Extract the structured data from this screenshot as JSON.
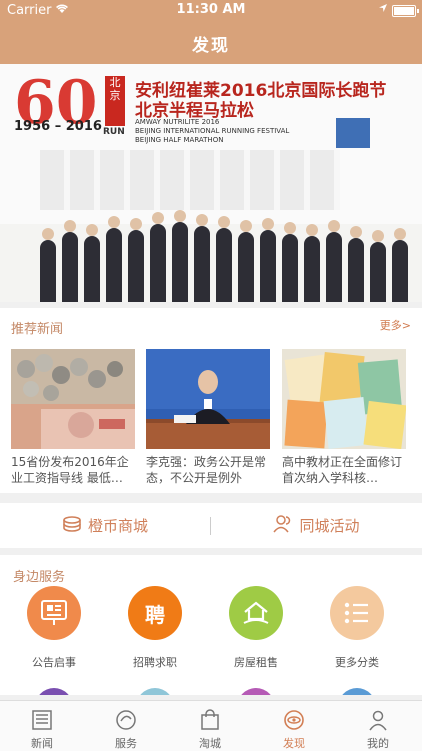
{
  "status_bar": {
    "carrier": "Carrier",
    "time": "11:30 AM"
  },
  "nav": {
    "title": "发现"
  },
  "banner": {
    "logo_number": "60",
    "logo_years": "1956 – 2016",
    "badge_text": "北京",
    "badge_run": "RUN",
    "title_line1": "安利纽崔莱2016北京国际长跑节",
    "title_line2": "北京半程马拉松",
    "subtitle_en": "AMWAY NUTRILITE 2016\nBEIJING INTERNATIONAL RUNNING FESTIVAL\nBEIJING HALF MARATHON",
    "page_count": 3,
    "active_page": 3
  },
  "recommended_news": {
    "section_title": "推荐新闻",
    "more_label": "更多>",
    "items": [
      {
        "text": "15省份发布2016年企业工资指导线 最低…",
        "image": "currency-image"
      },
      {
        "text": "李克强：政务公开是常态，不公开是例外",
        "image": "press-conference-image"
      },
      {
        "text": "高中教材正在全面修订 首次纳入学科核…",
        "image": "textbooks-image"
      }
    ]
  },
  "quick_links": {
    "coin_mall": "橙币商城",
    "city_events": "同城活动"
  },
  "nearby_services": {
    "section_title": "身边服务",
    "items": [
      {
        "label": "公告启事",
        "icon": "notice-board-icon",
        "color": "#f08a4b"
      },
      {
        "label": "招聘求职",
        "icon": "hiring-icon",
        "color": "#f07b16",
        "glyph": "聘"
      },
      {
        "label": "房屋租售",
        "icon": "house-hand-icon",
        "color": "#9fcb45"
      },
      {
        "label": "更多分类",
        "icon": "list-icon",
        "color": "#f4c99e"
      }
    ]
  },
  "tab_bar": {
    "active": 3,
    "tabs": [
      {
        "label": "新闻",
        "icon": "newspaper-icon"
      },
      {
        "label": "服务",
        "icon": "service-icon"
      },
      {
        "label": "淘城",
        "icon": "shopping-bag-icon"
      },
      {
        "label": "发现",
        "icon": "discover-eye-icon"
      },
      {
        "label": "我的",
        "icon": "person-icon"
      }
    ]
  },
  "colors": {
    "accent": "#d8a27a",
    "accent_text": "#d07a4e"
  }
}
